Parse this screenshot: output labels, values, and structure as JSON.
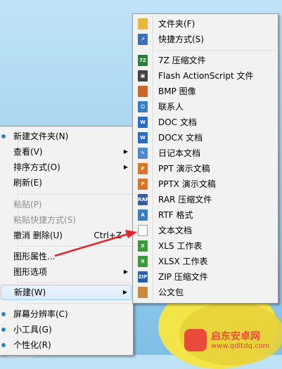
{
  "main_menu": {
    "items": [
      {
        "label": "新建文件夹(N)"
      },
      {
        "label": "查看(V)"
      },
      {
        "label": "排序方式(O)"
      },
      {
        "label": "刷新(E)"
      },
      {
        "label": "粘贴(P)"
      },
      {
        "label": "粘贴快捷方式(S)"
      },
      {
        "label": "撤消 删除(U)",
        "shortcut": "Ctrl+Z"
      },
      {
        "label": "图形属性..."
      },
      {
        "label": "图形选项"
      },
      {
        "label": "新建(W)"
      },
      {
        "label": "屏幕分辨率(C)"
      },
      {
        "label": "小工具(G)"
      },
      {
        "label": "个性化(R)"
      }
    ]
  },
  "sub_menu": {
    "items": [
      {
        "label": "文件夹(F)",
        "icon": "folder-icon",
        "color": "#e8b73c"
      },
      {
        "label": "快捷方式(S)",
        "icon": "shortcut-icon",
        "color": "#3b6fb6"
      },
      {
        "label": "7Z 压缩文件",
        "icon": "7z-archive-icon",
        "color": "#2f7d3a",
        "tag": "7Z"
      },
      {
        "label": "Flash ActionScript 文件",
        "icon": "flash-icon",
        "color": "#444444"
      },
      {
        "label": "BMP 图像",
        "icon": "image-icon",
        "color": "#c9672e"
      },
      {
        "label": "联系人",
        "icon": "contact-icon",
        "color": "#3b7dc4"
      },
      {
        "label": "DOC 文档",
        "icon": "doc-icon",
        "color": "#2b6cc4"
      },
      {
        "label": "DOCX 文档",
        "icon": "docx-icon",
        "color": "#2b6cc4"
      },
      {
        "label": "日记本文档",
        "icon": "journal-icon",
        "color": "#4b8ad0"
      },
      {
        "label": "PPT 演示文稿",
        "icon": "ppt-icon",
        "color": "#d9742b"
      },
      {
        "label": "PPTX 演示文稿",
        "icon": "pptx-icon",
        "color": "#d9742b"
      },
      {
        "label": "RAR 压缩文件",
        "icon": "rar-archive-icon",
        "color": "#3a5aa6",
        "tag": "RAR"
      },
      {
        "label": "RTF 格式",
        "icon": "rtf-icon",
        "color": "#3b7dc4"
      },
      {
        "label": "文本文档",
        "icon": "text-document-icon",
        "color": "#ffffff"
      },
      {
        "label": "XLS 工作表",
        "icon": "xls-icon",
        "color": "#3c9a3c"
      },
      {
        "label": "XLSX 工作表",
        "icon": "xlsx-icon",
        "color": "#3c9a3c"
      },
      {
        "label": "ZIP 压缩文件",
        "icon": "zip-archive-icon",
        "color": "#2a5ea8",
        "tag": "ZIP"
      },
      {
        "label": "公文包",
        "icon": "briefcase-icon",
        "color": "#c98b3a"
      }
    ]
  },
  "annotation": {
    "color": "#e0262b"
  },
  "watermark": {
    "title": "启东安卓网",
    "url": "www.qdltdq.com"
  }
}
